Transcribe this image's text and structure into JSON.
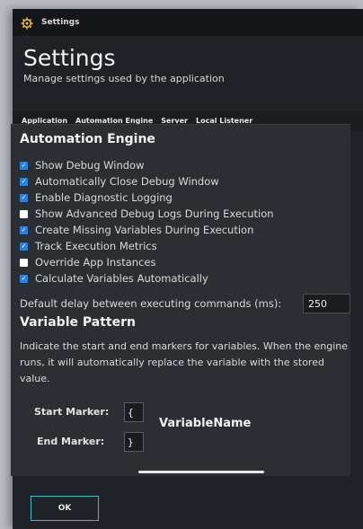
{
  "window": {
    "title": "Settings",
    "icon": "gear-icon"
  },
  "header": {
    "title": "Settings",
    "subtitle": "Manage settings used by the application"
  },
  "tabs": [
    {
      "label": "Application",
      "active": false
    },
    {
      "label": "Automation Engine",
      "active": true
    },
    {
      "label": "Server",
      "active": false
    },
    {
      "label": "Local Listener",
      "active": false
    }
  ],
  "automation_engine": {
    "section_title": "Automation Engine",
    "options": [
      {
        "label": "Show Debug Window",
        "checked": true
      },
      {
        "label": "Automatically Close Debug Window",
        "checked": true
      },
      {
        "label": "Enable Diagnostic Logging",
        "checked": true
      },
      {
        "label": "Show Advanced Debug Logs During Execution",
        "checked": false
      },
      {
        "label": "Create Missing Variables During Execution",
        "checked": true
      },
      {
        "label": "Track Execution Metrics",
        "checked": true
      },
      {
        "label": "Override App Instances",
        "checked": false
      },
      {
        "label": "Calculate Variables Automatically",
        "checked": true
      }
    ],
    "delay_label": "Default delay between executing commands (ms):",
    "delay_value": "250"
  },
  "variable_pattern": {
    "section_title": "Variable Pattern",
    "description": "Indicate the start and end markers for variables.  When the engine runs, it will automatically replace the variable with the stored value.",
    "start_marker_label": "Start Marker:",
    "start_marker_value": "{",
    "end_marker_label": "End Marker:",
    "end_marker_value": "}",
    "example_name": "VariableName"
  },
  "footer": {
    "ok_label": "OK"
  },
  "colors": {
    "accent": "#2f7fd6",
    "ok_border": "#3fb8c8",
    "background": "#1f2226"
  }
}
